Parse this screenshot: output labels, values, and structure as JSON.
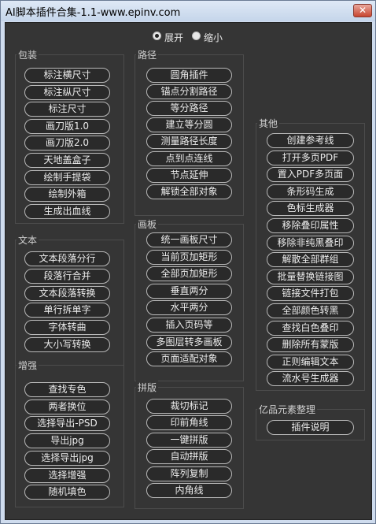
{
  "window": {
    "title": "AI脚本插件合集-1.1-www.epinv.com",
    "close_glyph": "✕"
  },
  "view_mode": {
    "options": [
      "展开",
      "缩小"
    ],
    "selected": "展开"
  },
  "groups": [
    {
      "title": "包装",
      "buttons": [
        "标注横尺寸",
        "标注纵尺寸",
        "标注尺寸",
        "画刀版1.0",
        "画刀版2.0",
        "天地盖盒子",
        "绘制手提袋",
        "绘制外箱",
        "生成出血线"
      ]
    },
    {
      "title": "文本",
      "buttons": [
        "文本段落分行",
        "段落行合并",
        "文本段落转换",
        "单行拆单字",
        "字体转曲",
        "大小写转换"
      ]
    },
    {
      "title": "增强",
      "buttons": [
        "查找专色",
        "两者换位",
        "选择导出-PSD",
        "导出jpg",
        "选择导出jpg",
        "选择增强",
        "随机填色"
      ]
    },
    {
      "title": "路径",
      "buttons": [
        "圆角插件",
        "锚点分割路径",
        "等分路径",
        "建立等分圆",
        "测量路径长度",
        "点到点连线",
        "节点延伸",
        "解锁全部对象"
      ]
    },
    {
      "title": "画板",
      "buttons": [
        "统一画板尺寸",
        "当前页加矩形",
        "全部页加矩形",
        "垂直两分",
        "水平两分",
        "插入页码等",
        "多图层转多画板",
        "页面适配对象"
      ]
    },
    {
      "title": "拼版",
      "buttons": [
        "裁切标记",
        "印前角线",
        "一键拼版",
        "自动拼版",
        "阵列复制",
        "内角线"
      ]
    },
    {
      "title": "其他",
      "buttons": [
        "创建参考线",
        "打开多页PDF",
        "置入PDF多页面",
        "条形码生成",
        "色标生成器",
        "移除叠印属性",
        "移除非纯黑叠印",
        "解散全部群组",
        "批量替换链接图",
        "链接文件打包",
        "全部颜色转黑",
        "查找白色叠印",
        "删除所有蒙版",
        "正则编辑文本",
        "流水号生成器"
      ]
    },
    {
      "title": "亿品元素整理",
      "buttons": [
        "插件说明"
      ]
    }
  ]
}
